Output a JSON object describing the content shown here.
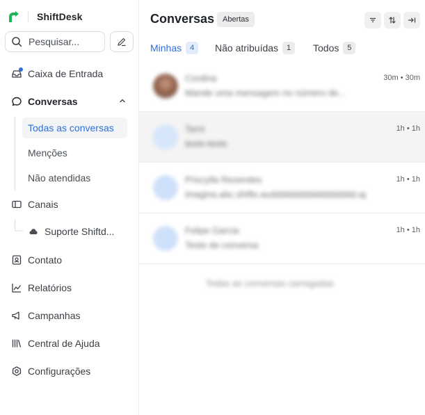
{
  "brand": {
    "name": "ShiftDesk"
  },
  "search": {
    "placeholder": "Pesquisar..."
  },
  "sidebar": {
    "inbox": "Caixa de Entrada",
    "conversations": "Conversas",
    "sub": [
      "Todas as conversas",
      "Menções",
      "Não atendidas"
    ],
    "channels": "Canais",
    "channel_inbox": "Suporte Shiftd...",
    "contact": "Contato",
    "reports": "Relatórios",
    "campaigns": "Campanhas",
    "help_center": "Central de Ajuda",
    "settings": "Configurações"
  },
  "header": {
    "title": "Conversas",
    "status": "Abertas"
  },
  "tabs": [
    {
      "label": "Minhas",
      "count": "4"
    },
    {
      "label": "Não atribuídas",
      "count": "1"
    },
    {
      "label": "Todos",
      "count": "5"
    }
  ],
  "conversations": [
    {
      "name": "Cordina",
      "message": "Mande uma mensagem no número de...",
      "time": "30m • 30m"
    },
    {
      "name": "Tarni",
      "message": "teste-teste",
      "time": "1h • 1h"
    },
    {
      "name": "Priscylla Rezendes",
      "message": "imagina.abc.shifto.auddddddddddddddddd.apos...",
      "time": "1h • 1h"
    },
    {
      "name": "Felipe Garcia",
      "message": "Teste de conversa",
      "time": "1h • 1h"
    }
  ],
  "end_text": "Todas as conversas carregadas",
  "colors": {
    "accent": "#2f6fdd",
    "brand": "#22b35b"
  }
}
